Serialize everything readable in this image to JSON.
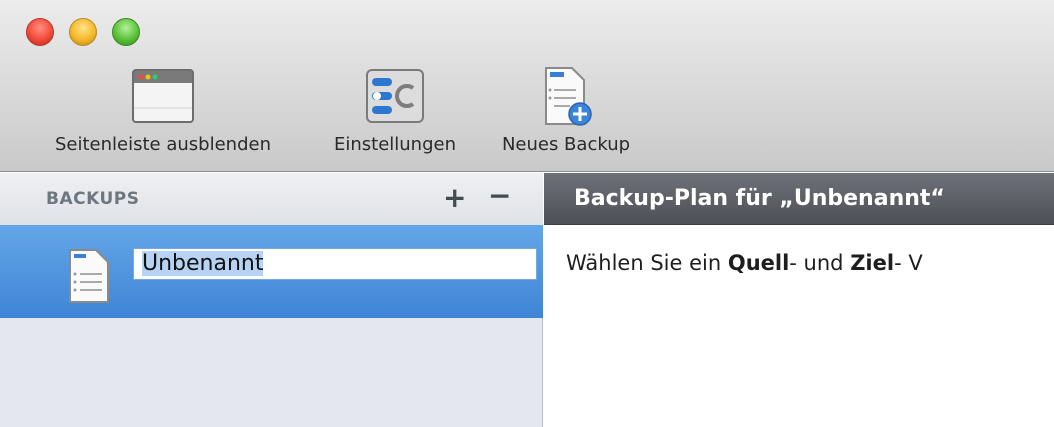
{
  "toolbar": {
    "sidebar_toggle_label": "Seitenleiste ausblenden",
    "settings_label": "Einstellungen",
    "new_backup_label": "Neues Backup"
  },
  "sidebar": {
    "title": "BACKUPS",
    "add_label": "+",
    "remove_label": "−",
    "items": [
      {
        "name": "Unbenannt",
        "icon": "document-icon"
      }
    ]
  },
  "main": {
    "header_title": "Backup-Plan für „Unbenannt“",
    "instruction_prefix": "Wählen Sie ein ",
    "instruction_source": "Quell",
    "instruction_middle": "- und ",
    "instruction_target": "Ziel",
    "instruction_suffix": "- V"
  },
  "colors": {
    "selection": "#3f85d6",
    "header_dark": "#4d5056"
  }
}
